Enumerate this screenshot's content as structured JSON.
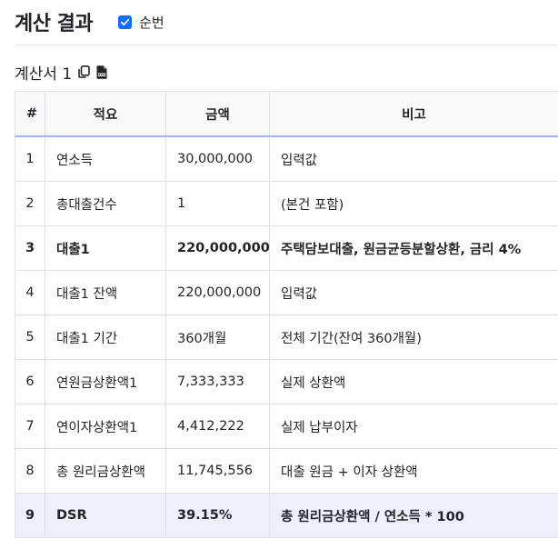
{
  "header": {
    "title": "계산 결과",
    "checkbox_label": "순번",
    "checkbox_checked": true,
    "accent_color": "#0d6efd"
  },
  "section": {
    "title": "계산서 1",
    "copy_icon": "copy-icon",
    "csv_icon": "csv-file-icon"
  },
  "table": {
    "headers": [
      "#",
      "적요",
      "금액",
      "비고"
    ],
    "rows": [
      {
        "no": "1",
        "item": "연소득",
        "amount": "30,000,000",
        "note": "입력값",
        "style": "normal"
      },
      {
        "no": "2",
        "item": "총대출건수",
        "amount": "1",
        "note": "(본건 포함)",
        "style": "normal"
      },
      {
        "no": "3",
        "item": "대출1",
        "amount": "220,000,000",
        "note": "주택담보대출, 원금균등분할상환, 금리 4%",
        "style": "bold"
      },
      {
        "no": "4",
        "item": "대출1 잔액",
        "amount": "220,000,000",
        "note": "입력값",
        "style": "normal"
      },
      {
        "no": "5",
        "item": "대출1 기간",
        "amount": "360개월",
        "note": "전체 기간(잔여 360개월)",
        "style": "normal"
      },
      {
        "no": "6",
        "item": "연원금상환액1",
        "amount": "7,333,333",
        "note": "실제 상환액",
        "style": "normal"
      },
      {
        "no": "7",
        "item": "연이자상환액1",
        "amount": "4,412,222",
        "note": "실제 납부이자",
        "style": "normal"
      },
      {
        "no": "8",
        "item": "총 원리금상환액",
        "amount": "11,745,556",
        "note": "대출 원금 + 이자 상환액",
        "style": "normal"
      },
      {
        "no": "9",
        "item": "DSR",
        "amount": "39.15%",
        "note": "총 원리금상환액 / 연소득 * 100",
        "style": "highlight"
      }
    ],
    "highlight_color": "#ecf0fc"
  }
}
